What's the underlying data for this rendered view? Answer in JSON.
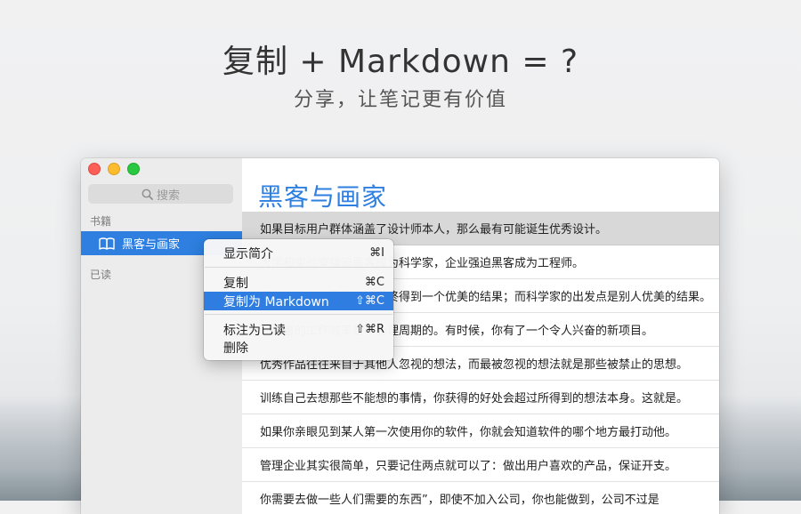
{
  "hero": {
    "title": "复制 + Markdown = ?",
    "subtitle": "分享，让笔记更有价值"
  },
  "sidebar": {
    "search_placeholder": "搜索",
    "section_books": "书籍",
    "selected_book": "黑客与画家",
    "section_read": "已读"
  },
  "main": {
    "book_title": "黑客与画家",
    "quotes": [
      "如果目标用户群体涵盖了设计师本人，那么最有可能诞生优秀设计。",
      "大学和实验室强迫黑客成为科学家，企业强迫黑客成为工程师。",
      "黑客的出发点是原创，最终得到一个优美的结果；而科学家的出发点是别人优美的结果。",
      "创作者的工作效率是有心理周期的。有时候，你有了一个令人兴奋的新项目。",
      "优秀作品往往来自于其他人忽视的想法，而最被忽视的想法就是那些被禁止的思想。",
      "训练自己去想那些不能想的事情，你获得的好处会超过所得到的想法本身。这就是。",
      "如果你亲眼见到某人第一次使用你的软件，你就会知道软件的哪个地方最打动他。",
      "管理企业其实很简单，只要记住两点就可以了：做出用户喜欢的产品，保证开支。",
      "你需要去做一些人们需要的东西”，即使不加入公司，你也能做到，公司不过是"
    ]
  },
  "context_menu": {
    "items": [
      {
        "label": "显示简介",
        "shortcut": "⌘I"
      },
      {
        "label": "复制",
        "shortcut": "⌘C"
      },
      {
        "label": "复制为 Markdown",
        "shortcut": "⇧⌘C"
      },
      {
        "label": "标注为已读",
        "shortcut": "⇧⌘R"
      },
      {
        "label": "删除",
        "shortcut": ""
      }
    ],
    "highlighted_index": 2,
    "highlight_color": "#2f7de1"
  },
  "colors": {
    "accent": "#2e7fe0"
  }
}
